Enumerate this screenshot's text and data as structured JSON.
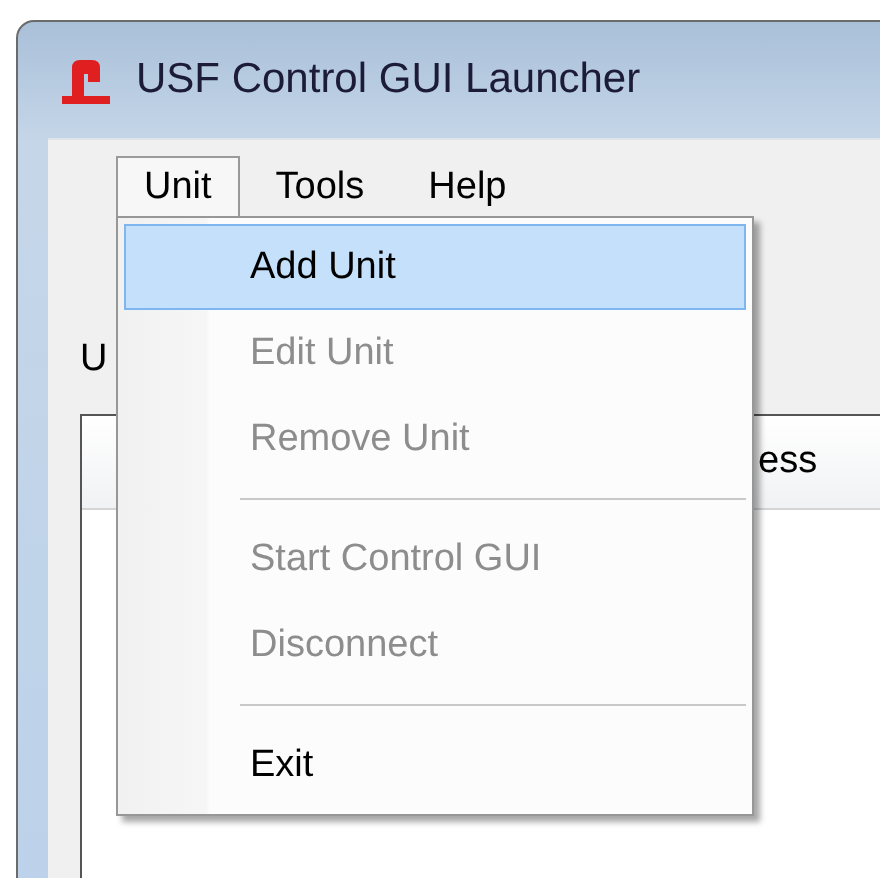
{
  "window": {
    "title": "USF Control GUI Launcher"
  },
  "menu_bar": [
    {
      "label": "Unit",
      "selected": true
    },
    {
      "label": "Tools",
      "selected": false
    },
    {
      "label": "Help",
      "selected": false
    }
  ],
  "menu": [
    {
      "kind": "item",
      "label": "Add Unit",
      "disabled": false,
      "selected": true
    },
    {
      "kind": "item",
      "label": "Edit Unit",
      "disabled": true,
      "selected": false
    },
    {
      "kind": "item",
      "label": "Remove Unit",
      "disabled": true,
      "selected": false
    },
    {
      "kind": "separator"
    },
    {
      "kind": "item",
      "label": "Start Control GUI",
      "disabled": true,
      "selected": false
    },
    {
      "kind": "item",
      "label": "Disconnect",
      "disabled": true,
      "selected": false
    },
    {
      "kind": "separator"
    },
    {
      "kind": "item",
      "label": "Exit",
      "disabled": false,
      "selected": false
    }
  ],
  "units_label": "U",
  "list": {
    "columns": [
      "ess"
    ]
  }
}
